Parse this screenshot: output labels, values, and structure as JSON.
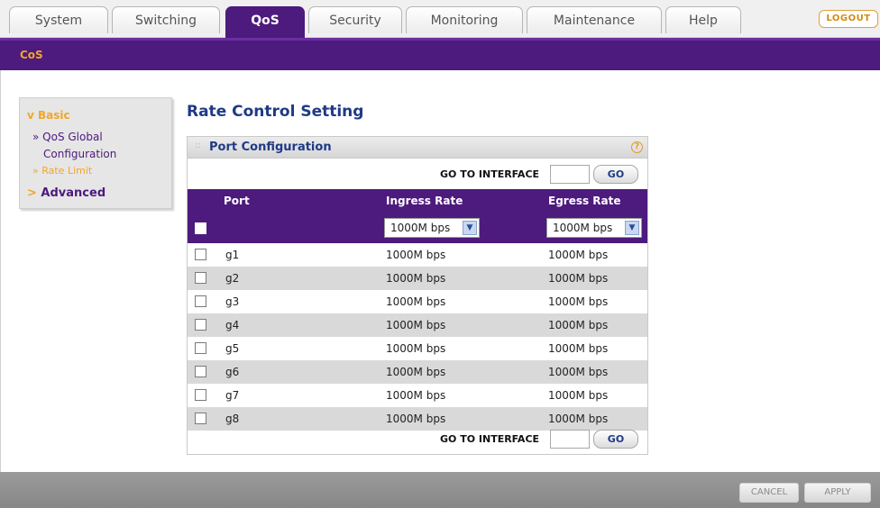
{
  "tabs": [
    "System",
    "Switching",
    "QoS",
    "Security",
    "Monitoring",
    "Maintenance",
    "Help"
  ],
  "active_tab": "QoS",
  "logout_label": "LOGOUT",
  "subnav": {
    "label": "CoS"
  },
  "sidebar": {
    "basic": "Basic",
    "items": [
      "» QoS Global",
      "Configuration",
      "» Rate Limit"
    ],
    "advanced": "Advanced"
  },
  "page_title": "Rate Control Setting",
  "panel": {
    "title": "Port Configuration",
    "goto_label": "GO TO INTERFACE",
    "go_label": "GO"
  },
  "table": {
    "headers": [
      "Port",
      "Ingress Rate",
      "Egress Rate"
    ],
    "all_ingress": "1000M bps",
    "all_egress": "1000M bps",
    "rows": [
      {
        "port": "g1",
        "ingress": "1000M bps",
        "egress": "1000M bps"
      },
      {
        "port": "g2",
        "ingress": "1000M bps",
        "egress": "1000M bps"
      },
      {
        "port": "g3",
        "ingress": "1000M bps",
        "egress": "1000M bps"
      },
      {
        "port": "g4",
        "ingress": "1000M bps",
        "egress": "1000M bps"
      },
      {
        "port": "g5",
        "ingress": "1000M bps",
        "egress": "1000M bps"
      },
      {
        "port": "g6",
        "ingress": "1000M bps",
        "egress": "1000M bps"
      },
      {
        "port": "g7",
        "ingress": "1000M bps",
        "egress": "1000M bps"
      },
      {
        "port": "g8",
        "ingress": "1000M bps",
        "egress": "1000M bps"
      }
    ]
  },
  "buttons": {
    "cancel": "CANCEL",
    "apply": "APPLY"
  },
  "colors": {
    "accent": "#4d1a7d",
    "highlight": "#f2a52a",
    "title": "#1f3a86"
  }
}
